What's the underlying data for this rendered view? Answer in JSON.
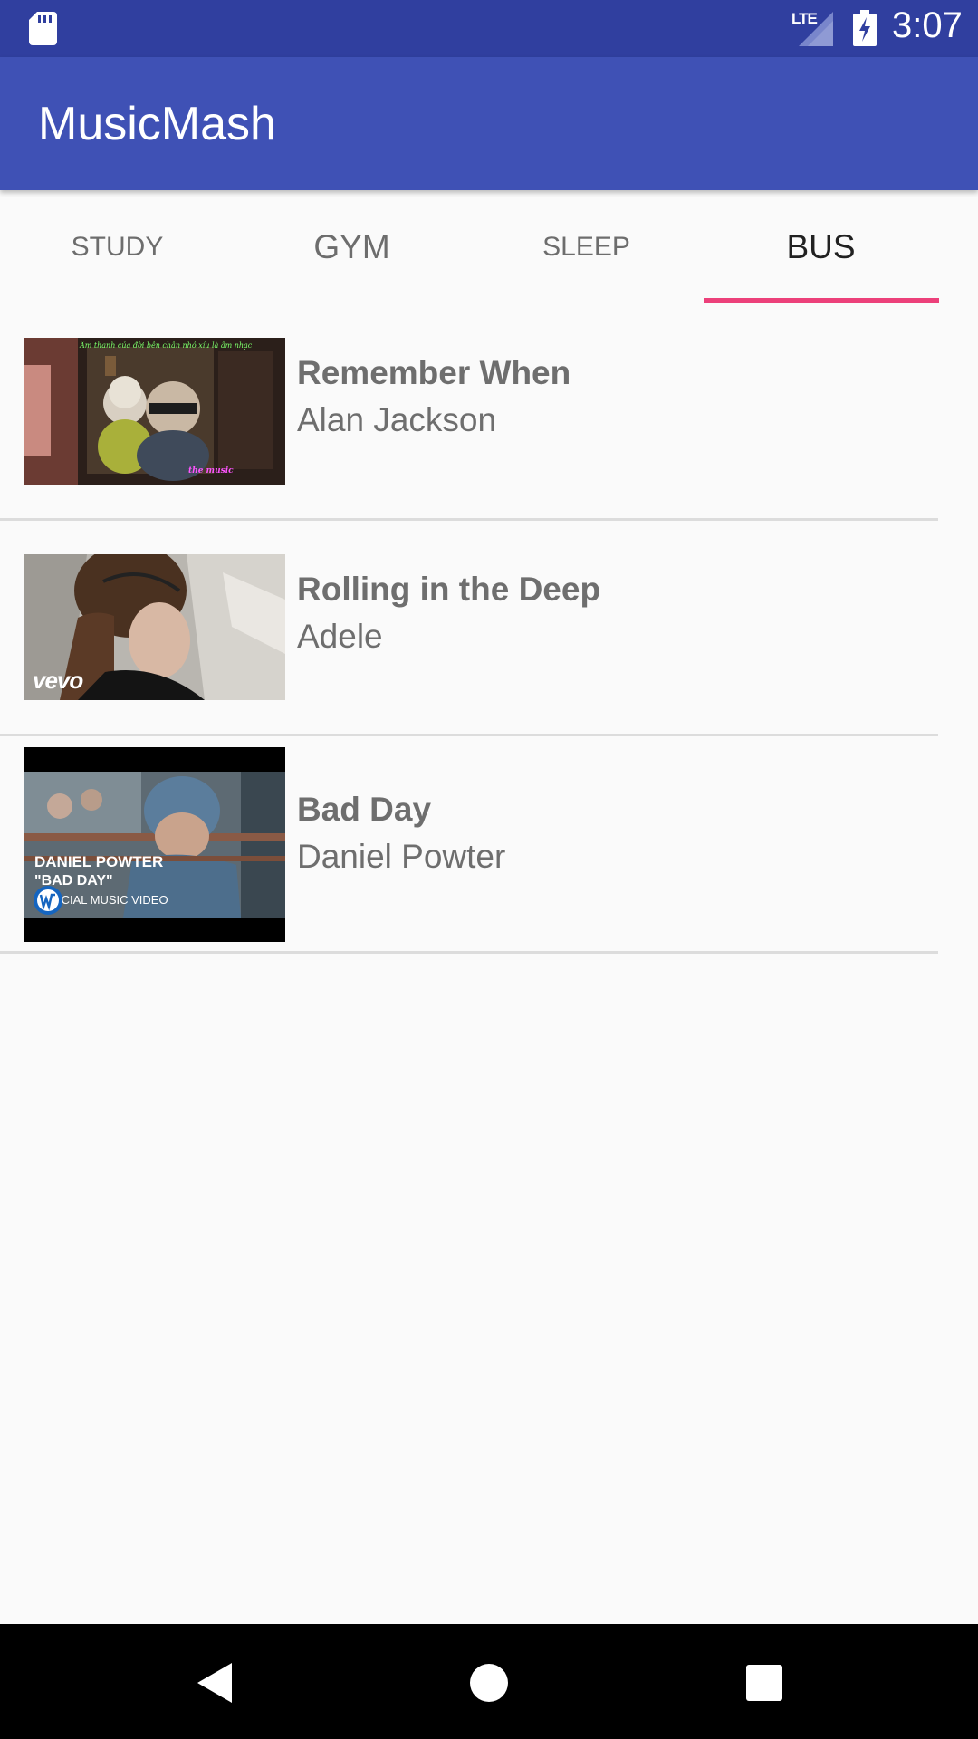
{
  "status_bar": {
    "network": "LTE",
    "time": "3:07"
  },
  "app_bar": {
    "title": "MusicMash"
  },
  "tabs": [
    {
      "label": "STUDY",
      "active": false
    },
    {
      "label": "GYM",
      "active": false
    },
    {
      "label": "SLEEP",
      "active": false
    },
    {
      "label": "BUS",
      "active": true
    }
  ],
  "tracks": [
    {
      "title": "Remember When",
      "artist": "Alan Jackson",
      "thumb_caption_top": "Âm thanh của đời bên chân nhỏ xíu là âm nhạc",
      "thumb_caption_bottom": "the music"
    },
    {
      "title": "Rolling in the Deep",
      "artist": "Adele",
      "thumb_logo": "vevo"
    },
    {
      "title": "Bad Day",
      "artist": "Daniel Powter",
      "thumb_line1": "DANIEL POWTER",
      "thumb_line2": "\"BAD DAY\"",
      "thumb_line3": "OFFICIAL MUSIC VIDEO"
    }
  ],
  "colors": {
    "primary": "#3f51b5",
    "primary_dark": "#303f9f",
    "accent": "#ec407a"
  },
  "icons": {
    "status_left": "sd-card-icon",
    "signal": "signal-icon",
    "battery": "battery-charging-icon",
    "nav_back": "back-icon",
    "nav_home": "home-icon",
    "nav_recents": "recents-icon"
  }
}
